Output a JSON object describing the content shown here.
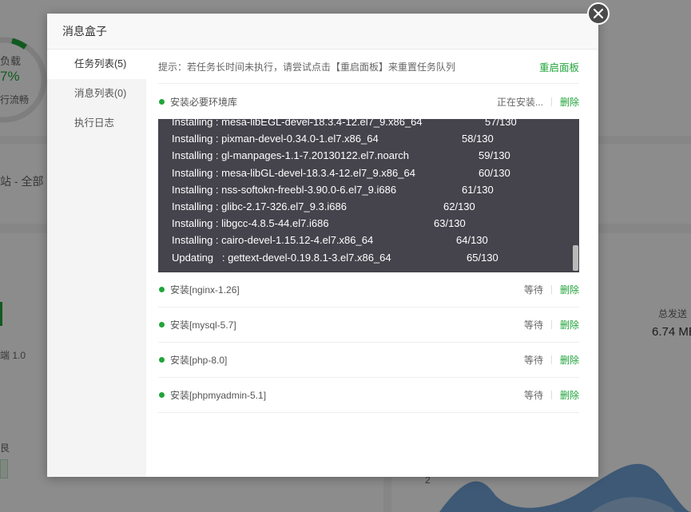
{
  "background": {
    "load_label": "负载",
    "load_percent": "7%",
    "load_status": "行流畅",
    "site_label": "站 - 全部",
    "version_label": "端 1.0",
    "total_send_label": "总发送",
    "total_send_value": "6.74 ME",
    "bottom_label": "艮",
    "chart_tick": "2"
  },
  "dialog": {
    "title": "消息盒子",
    "sidebar": [
      {
        "label": "任务列表(5)",
        "active": true
      },
      {
        "label": "消息列表(0)",
        "active": false
      },
      {
        "label": "执行日志",
        "active": false
      }
    ],
    "tip": "提示：若任务长时间未执行，请尝试点击【重启面板】来重置任务队列",
    "restart_label": "重启面板",
    "current_task": {
      "name": "安装必要环境库",
      "status": "正在安装...",
      "delete_label": "删除"
    },
    "log_lines": [
      {
        "text": "Installing : mesa-libEGL-devel-18.3.4-12.el7_9.x86_64",
        "count": "57/130"
      },
      {
        "text": "Installing : pixman-devel-0.34.0-1.el7.x86_64",
        "count": "58/130"
      },
      {
        "text": "Installing : gl-manpages-1.1-7.20130122.el7.noarch",
        "count": "59/130"
      },
      {
        "text": "Installing : mesa-libGL-devel-18.3.4-12.el7_9.x86_64",
        "count": "60/130"
      },
      {
        "text": "Installing : nss-softokn-freebl-3.90.0-6.el7_9.i686",
        "count": "61/130"
      },
      {
        "text": "Installing : glibc-2.17-326.el7_9.3.i686",
        "count": "62/130"
      },
      {
        "text": "Installing : libgcc-4.8.5-44.el7.i686",
        "count": "63/130"
      },
      {
        "text": "Installing : cairo-devel-1.15.12-4.el7.x86_64",
        "count": "64/130"
      },
      {
        "text": "Updating   : gettext-devel-0.19.8.1-3.el7.x86_64",
        "count": "65/130"
      }
    ],
    "queued_tasks": [
      {
        "name": "安装[nginx-1.26]",
        "status": "等待",
        "delete_label": "删除"
      },
      {
        "name": "安装[mysql-5.7]",
        "status": "等待",
        "delete_label": "删除"
      },
      {
        "name": "安装[php-8.0]",
        "status": "等待",
        "delete_label": "删除"
      },
      {
        "name": "安装[phpmyadmin-5.1]",
        "status": "等待",
        "delete_label": "删除"
      }
    ]
  },
  "colors": {
    "accent": "#20a53a",
    "console_bg": "#45434c"
  }
}
